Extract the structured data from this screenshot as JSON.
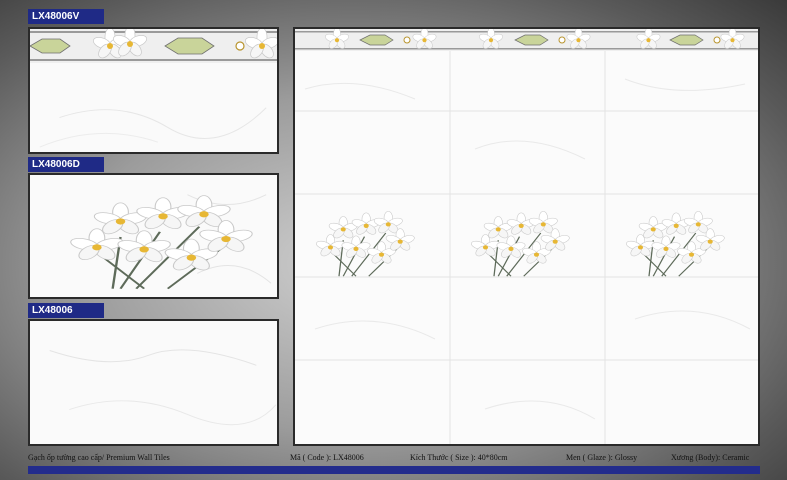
{
  "swatches": [
    {
      "code": "LX48006V",
      "kind": "border"
    },
    {
      "code": "LX48006D",
      "kind": "decor"
    },
    {
      "code": "LX48006",
      "kind": "plain"
    }
  ],
  "footer": {
    "product_line": "Gạch ốp tường cao cấp/ Premium Wall Tiles",
    "code": "Mã ( Code ): LX48006",
    "size": "Kích Thước ( Size ): 40*80cm",
    "glaze": "Men ( Glaze ): Glossy",
    "body": "Xương (Body): Ceramic"
  },
  "colors": {
    "label_bg": "#1f2a86",
    "footer_bar": "#232c8c",
    "tile_bg": "#fafafa"
  }
}
